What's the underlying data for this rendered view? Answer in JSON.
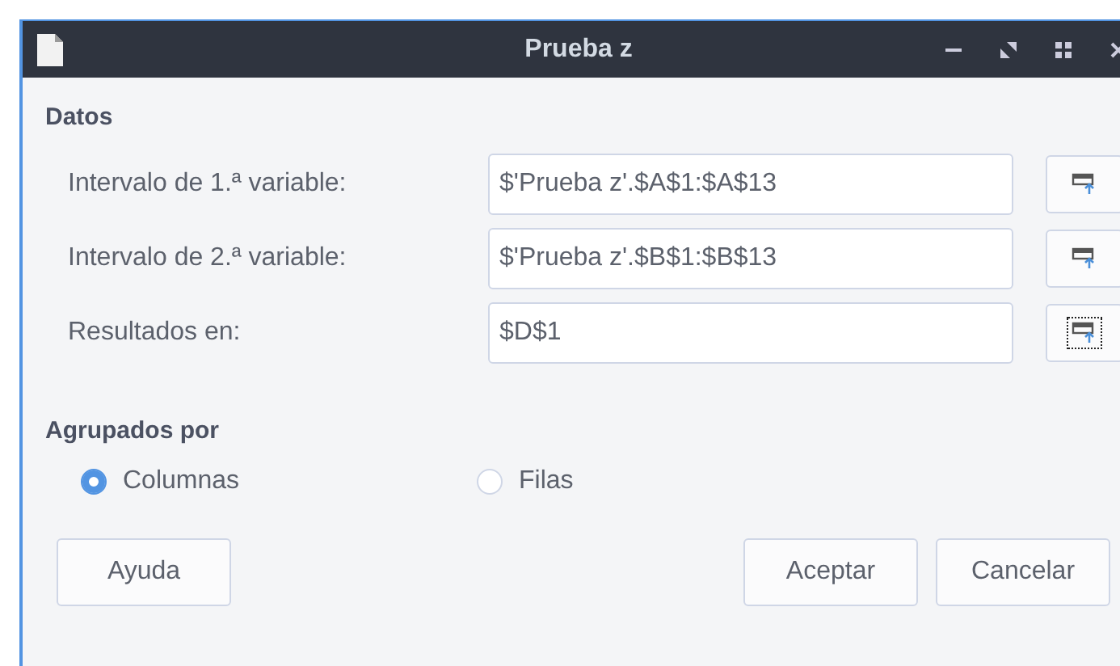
{
  "window": {
    "title": "Prueba z"
  },
  "data_section": {
    "heading": "Datos",
    "rows": [
      {
        "label": "Intervalo de 1.ª variable:",
        "value": "$'Prueba z'.$A$1:$A$13",
        "picker_focused": false
      },
      {
        "label": "Intervalo de 2.ª variable:",
        "value": "$'Prueba z'.$B$1:$B$13",
        "picker_focused": false
      },
      {
        "label": "Resultados en:",
        "value": "$D$1",
        "picker_focused": true
      }
    ]
  },
  "grouped_by": {
    "heading": "Agrupados por",
    "options": [
      {
        "label": "Columnas",
        "selected": true
      },
      {
        "label": "Filas",
        "selected": false
      }
    ]
  },
  "buttons": {
    "left": [
      "Ayuda"
    ],
    "right": [
      "Aceptar",
      "Cancelar"
    ]
  }
}
